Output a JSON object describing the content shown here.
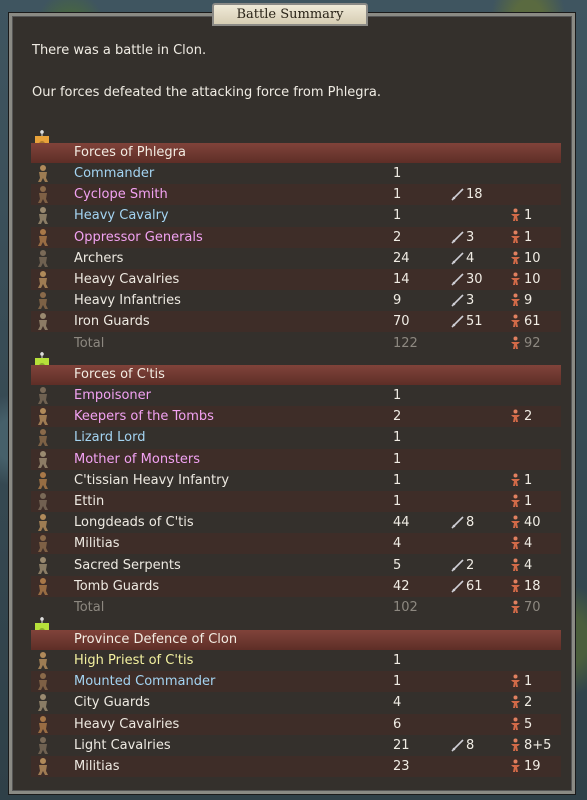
{
  "window": {
    "title": "Battle Summary"
  },
  "intro": {
    "line1": "There was a battle in Clon.",
    "line2": "Our forces defeated the attacking force from Phlegra."
  },
  "colors": {
    "commander_blue": "#a4d4f2",
    "commander_pink": "#f2a2f2",
    "unit_white": "#eeeae2",
    "priest_yellow": "#f3f1a0",
    "total_gray": "#8d8880",
    "header_red": "#80433a",
    "banner_orange": "#e8a23a",
    "banner_green": "#b6e03a"
  },
  "groups": [
    {
      "title": "Forces of Phlegra",
      "banner_icon": "orange-banner-icon",
      "rows": [
        {
          "name": "Commander",
          "color": "blue",
          "count": "1",
          "kills": "",
          "lost": ""
        },
        {
          "name": "Cyclope Smith",
          "color": "pink",
          "count": "1",
          "kills": "18",
          "lost": ""
        },
        {
          "name": "Heavy Cavalry",
          "color": "blue",
          "count": "1",
          "kills": "",
          "lost": "1"
        },
        {
          "name": "Oppressor Generals",
          "color": "pink",
          "count": "2",
          "kills": "3",
          "lost": "1"
        },
        {
          "name": "Archers",
          "color": "white",
          "count": "24",
          "kills": "4",
          "lost": "10"
        },
        {
          "name": "Heavy Cavalries",
          "color": "white",
          "count": "14",
          "kills": "30",
          "lost": "10"
        },
        {
          "name": "Heavy Infantries",
          "color": "white",
          "count": "9",
          "kills": "3",
          "lost": "9"
        },
        {
          "name": "Iron Guards",
          "color": "white",
          "count": "70",
          "kills": "51",
          "lost": "61"
        },
        {
          "name": "Total",
          "color": "gray",
          "count": "122",
          "kills": "",
          "lost": "92",
          "total": true
        }
      ]
    },
    {
      "title": "Forces of C'tis",
      "banner_icon": "green-banner-icon",
      "rows": [
        {
          "name": "Empoisoner",
          "color": "pink",
          "count": "1",
          "kills": "",
          "lost": ""
        },
        {
          "name": "Keepers of the Tombs",
          "color": "pink",
          "count": "2",
          "kills": "",
          "lost": "2"
        },
        {
          "name": "Lizard Lord",
          "color": "blue",
          "count": "1",
          "kills": "",
          "lost": ""
        },
        {
          "name": "Mother of Monsters",
          "color": "pink",
          "count": "1",
          "kills": "",
          "lost": ""
        },
        {
          "name": "C'tissian Heavy Infantry",
          "color": "white",
          "count": "1",
          "kills": "",
          "lost": "1"
        },
        {
          "name": "Ettin",
          "color": "white",
          "count": "1",
          "kills": "",
          "lost": "1"
        },
        {
          "name": "Longdeads of C'tis",
          "color": "white",
          "count": "44",
          "kills": "8",
          "lost": "40"
        },
        {
          "name": "Militias",
          "color": "white",
          "count": "4",
          "kills": "",
          "lost": "4"
        },
        {
          "name": "Sacred Serpents",
          "color": "white",
          "count": "5",
          "kills": "2",
          "lost": "4"
        },
        {
          "name": "Tomb Guards",
          "color": "white",
          "count": "42",
          "kills": "61",
          "lost": "18"
        },
        {
          "name": "Total",
          "color": "gray",
          "count": "102",
          "kills": "",
          "lost": "70",
          "total": true
        }
      ]
    },
    {
      "title": "Province Defence of Clon",
      "banner_icon": "green-banner-icon",
      "rows": [
        {
          "name": "High Priest of C'tis",
          "color": "yellow",
          "count": "1",
          "kills": "",
          "lost": ""
        },
        {
          "name": "Mounted Commander",
          "color": "blue",
          "count": "1",
          "kills": "",
          "lost": "1"
        },
        {
          "name": "City Guards",
          "color": "white",
          "count": "4",
          "kills": "",
          "lost": "2"
        },
        {
          "name": "Heavy Cavalries",
          "color": "white",
          "count": "6",
          "kills": "",
          "lost": "5"
        },
        {
          "name": "Light Cavalries",
          "color": "white",
          "count": "21",
          "kills": "8",
          "lost": "8+5"
        },
        {
          "name": "Militias",
          "color": "white",
          "count": "23",
          "kills": "",
          "lost": "19"
        }
      ]
    }
  ]
}
